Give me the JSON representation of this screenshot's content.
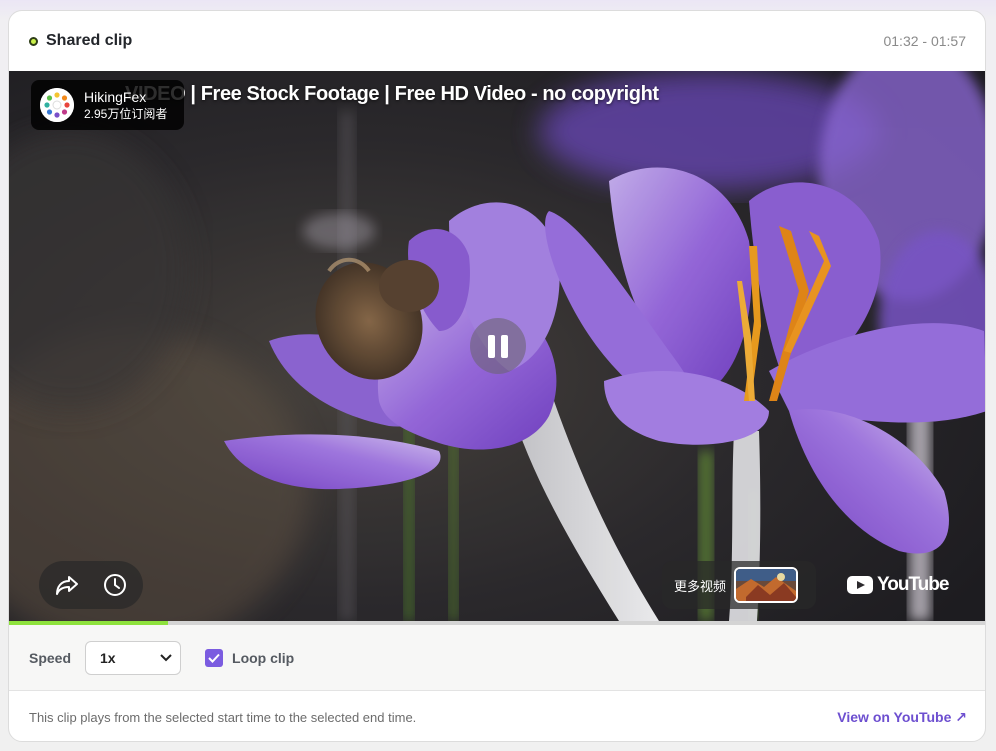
{
  "header": {
    "title": "Shared clip",
    "time_range": "01:32 - 01:57"
  },
  "video": {
    "title": "VIDEO | Free Stock Footage | Free HD Video - no copyright",
    "channel_name": "HikingFex",
    "channel_subscribers": "2.95万位订阅者",
    "more_videos_label": "更多视频",
    "youtube_label": "YouTube",
    "progress": 0.163
  },
  "controls": {
    "speed_label": "Speed",
    "speed_value": "1x",
    "loop_label": "Loop clip",
    "loop_checked": true
  },
  "footer": {
    "note": "This clip plays from the selected start time to the selected end time.",
    "link": "View on YouTube ↗"
  },
  "colors": {
    "accent": "#6d4fd0",
    "progress": "#8ee23d",
    "checkbox": "#7b5ce0"
  }
}
